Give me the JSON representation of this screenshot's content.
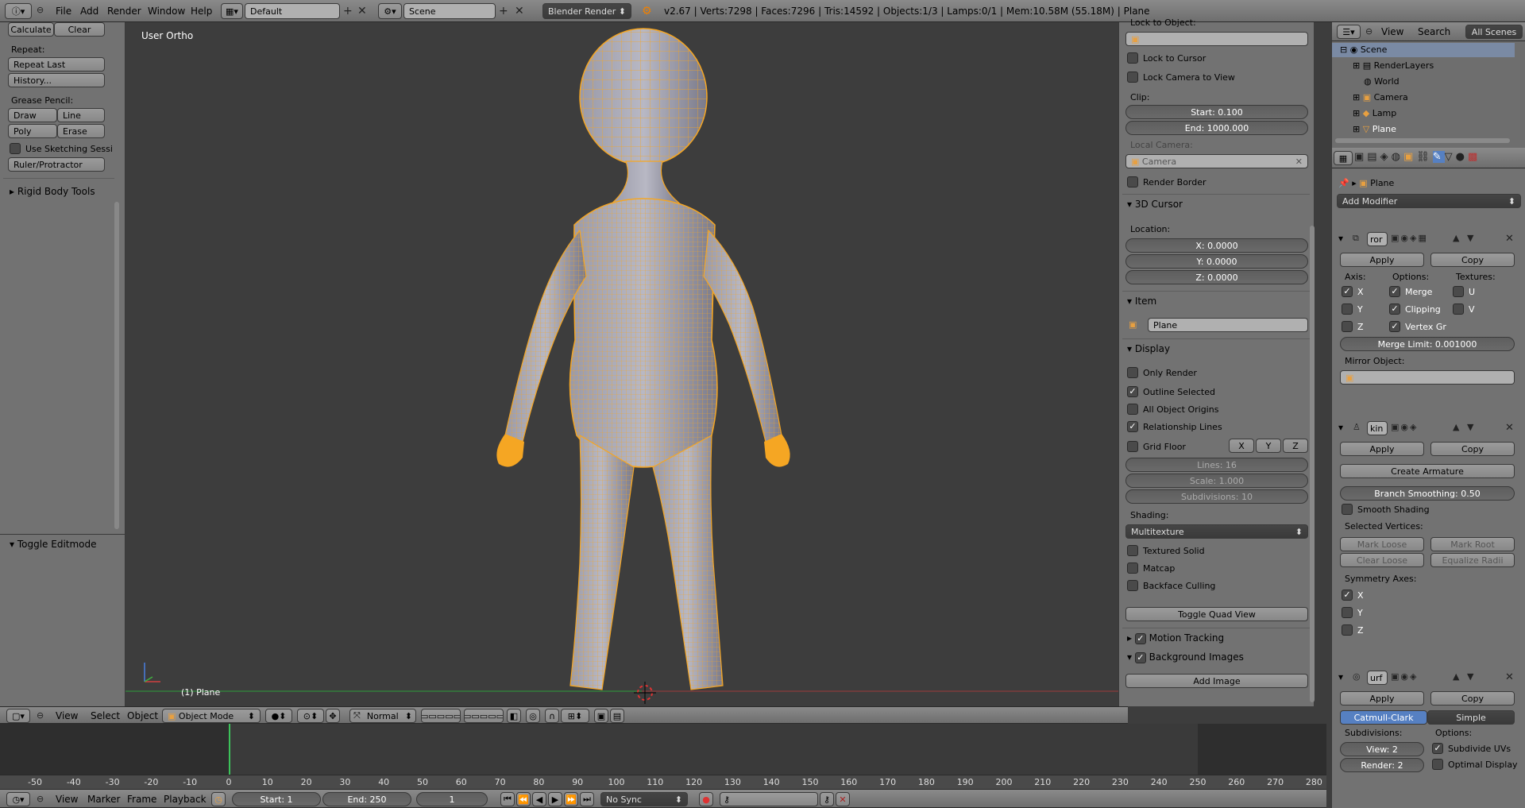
{
  "top_bar": {
    "menus": [
      "File",
      "Add",
      "Render",
      "Window",
      "Help"
    ],
    "layout": "Default",
    "scene": "Scene",
    "engine": "Blender Render",
    "stats": "v2.67 | Verts:7298 | Faces:7296 | Tris:14592 | Objects:1/3 | Lamps:0/1 | Mem:10.58M (55.18M) | Plane"
  },
  "toolshelf": {
    "calculate": "Calculate",
    "clear": "Clear",
    "repeat_label": "Repeat:",
    "repeat_last": "Repeat Last",
    "history": "History...",
    "grease_label": "Grease Pencil:",
    "draw": "Draw",
    "line": "Line",
    "poly": "Poly",
    "erase": "Erase",
    "sketch": "Use Sketching Sessi",
    "ruler": "Ruler/Protractor",
    "rigid": "Rigid Body Tools",
    "toggle_editmode": "Toggle Editmode"
  },
  "viewport": {
    "view_label": "User Ortho",
    "object_label": "(1) Plane"
  },
  "properties_panel": {
    "lock_to_object": "Lock to Object:",
    "lock_to_cursor": "Lock to Cursor",
    "lock_camera": "Lock Camera to View",
    "clip": "Clip:",
    "clip_start": "Start: 0.100",
    "clip_end": "End: 1000.000",
    "local_camera": "Local Camera:",
    "camera_value": "Camera",
    "render_border": "Render Border",
    "cursor_header": "3D Cursor",
    "location": "Location:",
    "x": "X: 0.0000",
    "y": "Y: 0.0000",
    "z": "Z: 0.0000",
    "item_header": "Item",
    "item_name": "Plane",
    "display_header": "Display",
    "only_render": "Only Render",
    "outline_selected": "Outline Selected",
    "all_origins": "All Object Origins",
    "relationship_lines": "Relationship Lines",
    "grid_floor": "Grid Floor",
    "ax_x": "X",
    "ax_y": "Y",
    "ax_z": "Z",
    "lines": "Lines: 16",
    "scale": "Scale: 1.000",
    "subdivisions": "Subdivisions: 10",
    "shading": "Shading:",
    "shading_value": "Multitexture",
    "textured_solid": "Textured Solid",
    "matcap": "Matcap",
    "backface": "Backface Culling",
    "toggle_quad": "Toggle Quad View",
    "motion_tracking": "Motion Tracking",
    "bg_images": "Background Images",
    "add_image": "Add Image"
  },
  "outliner": {
    "view": "View",
    "search": "Search",
    "all_scenes": "All Scenes",
    "items": [
      "Scene",
      "RenderLayers",
      "World",
      "Camera",
      "Lamp",
      "Plane"
    ]
  },
  "modifiers": {
    "object_name": "Plane",
    "add_modifier": "Add Modifier",
    "mirror_name": "ror",
    "apply": "Apply",
    "copy": "Copy",
    "axis": "Axis:",
    "options": "Options:",
    "textures": "Textures:",
    "x": "X",
    "y": "Y",
    "z": "Z",
    "merge": "Merge",
    "clipping": "Clipping",
    "vertex_gr": "Vertex Gr",
    "u": "U",
    "v": "V",
    "merge_limit": "Merge Limit: 0.001000",
    "mirror_object": "Mirror Object:",
    "skin_name": "kin",
    "create_armature": "Create Armature",
    "branch_smoothing": "Branch Smoothing: 0.50",
    "smooth_shading": "Smooth Shading",
    "selected_vertices": "Selected Vertices:",
    "mark_loose": "Mark Loose",
    "mark_root": "Mark Root",
    "clear_loose": "Clear Loose",
    "equalize_radii": "Equalize Radii",
    "symmetry_axes": "Symmetry Axes:",
    "subsurf_name": "urf",
    "catmull": "Catmull-Clark",
    "simple": "Simple",
    "subdivisions": "Subdivisions:",
    "sub_options": "Options:",
    "view_level": "View: 2",
    "render_level": "Render: 2",
    "subdivide_uvs": "Subdivide UVs",
    "optimal_display": "Optimal Display"
  },
  "view3d_header": {
    "menus": [
      "View",
      "Select",
      "Object"
    ],
    "mode": "Object Mode",
    "pivot": "Normal"
  },
  "timeline": {
    "ticks": [
      "-50",
      "-40",
      "-30",
      "-20",
      "-10",
      "0",
      "10",
      "20",
      "30",
      "40",
      "50",
      "60",
      "70",
      "80",
      "90",
      "100",
      "110",
      "120",
      "130",
      "140",
      "150",
      "160",
      "170",
      "180",
      "190",
      "200",
      "210",
      "220",
      "230",
      "240",
      "250",
      "260",
      "270",
      "280"
    ],
    "menus": [
      "View",
      "Marker",
      "Frame",
      "Playback"
    ],
    "start": "Start: 1",
    "end": "End: 250",
    "current": "1",
    "sync": "No Sync"
  },
  "colors": {
    "accent": "#5680c2",
    "selection": "#f5a623",
    "frame_marker": "#3cc25a"
  }
}
